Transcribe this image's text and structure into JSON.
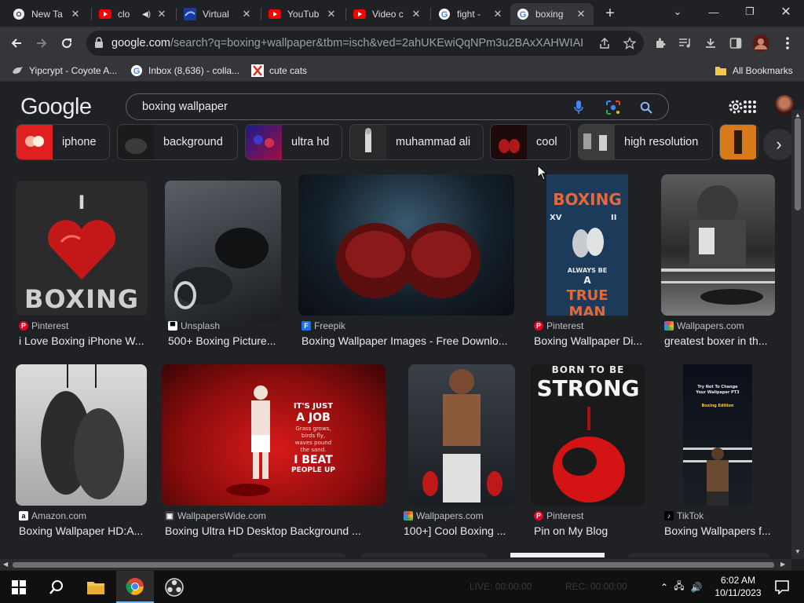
{
  "browser": {
    "tabs": [
      {
        "title": "New Ta",
        "favicon": "chrome-icon",
        "active": false
      },
      {
        "title": "clo",
        "favicon": "youtube-icon",
        "audio": true,
        "active": false
      },
      {
        "title": "Virtual",
        "favicon": "virtual-icon",
        "active": false
      },
      {
        "title": "YouTub",
        "favicon": "youtube-icon",
        "active": false
      },
      {
        "title": "Video c",
        "favicon": "youtube-icon",
        "active": false
      },
      {
        "title": "fight - ",
        "favicon": "google-icon",
        "active": false
      },
      {
        "title": "boxing",
        "favicon": "google-icon",
        "active": true
      }
    ],
    "url_host": "google.com",
    "url_path": "/search?q=boxing+wallpaper&tbm=isch&ved=2ahUKEwiQqNPm3u2BAxXAHWIAH...",
    "bookmarks": [
      {
        "label": "Yipcrypt - Coyote A...",
        "icon": "bird-icon"
      },
      {
        "label": "Inbox (8,636) - colla...",
        "icon": "google-icon"
      },
      {
        "label": "cute cats",
        "icon": "x-icon"
      }
    ],
    "all_bookmarks_label": "All Bookmarks"
  },
  "google": {
    "logo": "Google",
    "query": "boxing wallpaper",
    "chips": [
      "iphone",
      "background",
      "ultra hd",
      "muhammad ali",
      "cool",
      "high resolution"
    ]
  },
  "results": [
    {
      "source": "Pinterest",
      "title": "i Love Boxing iPhone W...",
      "source_icon": "pinterest-icon",
      "img_text": [
        "I",
        "BOXING"
      ]
    },
    {
      "source": "Unsplash",
      "title": "500+ Boxing Picture...",
      "source_icon": "unsplash-icon"
    },
    {
      "source": "Freepik",
      "title": "Boxing Wallpaper Images - Free Downlo...",
      "source_icon": "freepik-icon"
    },
    {
      "source": "Pinterest",
      "title": "Boxing Wallpaper Di...",
      "source_icon": "pinterest-icon",
      "img_text": [
        "BOXING",
        "XV",
        "II",
        "ALWAYS BE",
        "A",
        "TRUE MAN"
      ]
    },
    {
      "source": "Wallpapers.com",
      "title": "greatest boxer in th...",
      "source_icon": "wallpapers-icon"
    },
    {
      "source": "Amazon.com",
      "title": "Boxing Wallpaper HD:A...",
      "source_icon": "amazon-icon"
    },
    {
      "source": "WallpapersWide.com",
      "title": "Boxing Ultra HD Desktop Background ...",
      "source_icon": "wallpaperswide-icon",
      "img_text": [
        "IT'S JUST",
        "A JOB",
        "Grass grows,",
        "birds fly,",
        "waves pound",
        "the sand.",
        "I BEAT",
        "PEOPLE UP"
      ]
    },
    {
      "source": "Wallpapers.com",
      "title": "100+] Cool Boxing ...",
      "source_icon": "wallpapers-icon"
    },
    {
      "source": "Pinterest",
      "title": "Pin on My Blog",
      "source_icon": "pinterest-icon",
      "img_text": [
        "BORN TO BE",
        "STRONG"
      ]
    },
    {
      "source": "TikTok",
      "title": "Boxing Wallpapers f...",
      "source_icon": "tiktok-icon",
      "img_text": [
        "Try Not To Change",
        "Your Wallpaper PT3",
        "Boxing Edition"
      ]
    }
  ],
  "taskbar": {
    "time": "6:02 AM",
    "date": "10/11/2023",
    "overlay_live": "LIVE: 00:00:00",
    "overlay_rec": "REC: 00:00:00"
  },
  "colors": {
    "page_bg": "#202124",
    "toolbar_bg": "#35363a",
    "chip_border": "#3c4043",
    "text_primary": "#e8eaed",
    "text_secondary": "#bdc1c6",
    "mic_blue": "#4285f4",
    "search_blue": "#8ab4f8"
  }
}
